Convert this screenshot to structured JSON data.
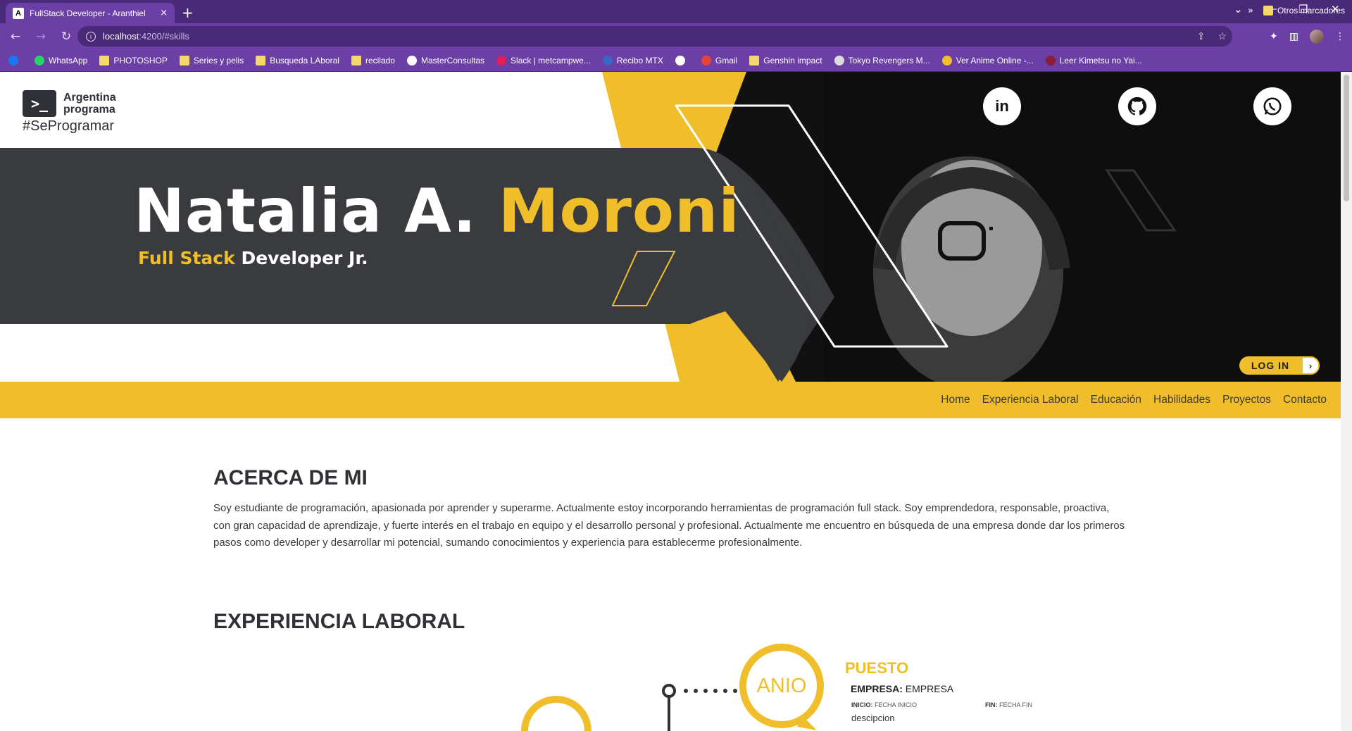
{
  "browser": {
    "tab_title": "FullStack Developer - Aranthiel",
    "tab_favicon": "A",
    "tab_close": "×",
    "new_tab": "+",
    "url_host": "localhost",
    "url_path": ":4200/#skills",
    "window_controls": [
      "⌄",
      "—",
      "❐",
      "✕"
    ],
    "bookmarks": [
      {
        "label": "WhatsApp",
        "icon": "whatsapp-icon",
        "color": "#25d366"
      },
      {
        "label": "PHOTOSHOP",
        "icon": "folder-icon",
        "color": "#f5d86b"
      },
      {
        "label": "Series y pelis",
        "icon": "folder-icon",
        "color": "#f5d86b"
      },
      {
        "label": "Busqueda LAboral",
        "icon": "folder-icon",
        "color": "#f5d86b"
      },
      {
        "label": "recilado",
        "icon": "folder-icon",
        "color": "#f5d86b"
      },
      {
        "label": "MasterConsultas",
        "icon": "globe-icon",
        "color": "#ffffff"
      },
      {
        "label": "Slack | metcampwe...",
        "icon": "slack-icon",
        "color": "#e01e5a"
      },
      {
        "label": "Recibo MTX",
        "icon": "page-icon",
        "color": "#3a66c8"
      },
      {
        "label": "",
        "icon": "globe-icon",
        "color": "#ffffff"
      },
      {
        "label": "Gmail",
        "icon": "gmail-icon",
        "color": "#ea4335"
      },
      {
        "label": "Genshin impact",
        "icon": "folder-icon",
        "color": "#f5d86b"
      },
      {
        "label": "Tokyo Revengers M...",
        "icon": "site-icon",
        "color": "#dddddd"
      },
      {
        "label": "Ver Anime Online -...",
        "icon": "anime-icon",
        "color": "#f0be2b"
      },
      {
        "label": "Leer Kimetsu no Yai...",
        "icon": "manga-icon",
        "color": "#8a1c3c"
      }
    ],
    "bookmarks_more": "»",
    "other_bookmarks": "Otros marcadores"
  },
  "header": {
    "logo_symbol": ">_",
    "logo_line1": "Argentina",
    "logo_line2": "programa",
    "logo_tag": "#SeProgramar",
    "first_name": "Natalia A.",
    "last_name": "Moroni",
    "role_highlight": "Full Stack",
    "role_rest": "Developer Jr.",
    "social": [
      {
        "label": "in",
        "icon": "linkedin-icon"
      },
      {
        "label": "",
        "icon": "github-icon"
      },
      {
        "label": "",
        "icon": "whatsapp-icon"
      }
    ],
    "login_label": "LOG IN",
    "login_arrow": "›"
  },
  "nav": [
    "Home",
    "Experiencia Laboral",
    "Educación",
    "Habilidades",
    "Proyectos",
    "Contacto"
  ],
  "about": {
    "title": "ACERCA DE MI",
    "text": "Soy estudiante de programación, apasionada por aprender y superarme. Actualmente estoy incorporando herramientas de programación full stack. Soy emprendedora, responsable, proactiva, con gran capacidad de aprendizaje, y fuerte interés en el trabajo en equipo y el desarrollo personal y profesional. Actualmente me encuentro en búsqueda de una empresa donde dar los primeros pasos como developer y desarrollar mi potencial, sumando conocimientos y experiencia para establecerme profesionalmente."
  },
  "experience": {
    "title": "EXPERIENCIA LABORAL",
    "year": "ANIO",
    "position": "PUESTO",
    "company_label": "EMPRESA:",
    "company": "EMPRESA",
    "start_label": "INICIO:",
    "start": "FECHA INICIO",
    "end_label": "FIN:",
    "end": "FECHA FIN",
    "description": "descipcion"
  },
  "colors": {
    "accent": "#f0be2b",
    "dark": "#3a3b3f",
    "browser": "#6b3fa6"
  }
}
